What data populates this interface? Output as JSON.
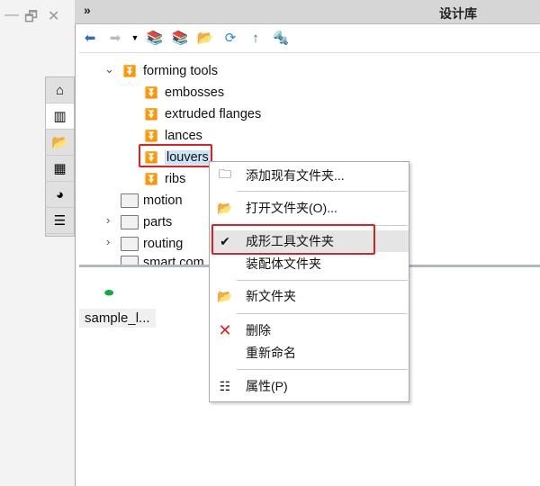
{
  "window": {
    "title": "设计库",
    "expand_icon": "double-chevron-right-icon"
  },
  "toolbar": [
    "back-icon",
    "forward-icon",
    "dropdown-icon",
    "add-library-icon",
    "new-library-icon",
    "new-folder-icon",
    "refresh-icon",
    "up-icon",
    "toolbox-icon"
  ],
  "tabs": [
    "home-icon",
    "design-library-icon",
    "file-explorer-icon",
    "view-palette-icon",
    "appearances-icon",
    "custom-properties-icon"
  ],
  "tree": {
    "root": "forming tools",
    "children": [
      "embosses",
      "extruded flanges",
      "lances",
      "louvers",
      "ribs"
    ],
    "siblings": [
      "motion",
      "parts",
      "routing",
      "smart com..."
    ],
    "selected": "louvers"
  },
  "lower": {
    "file": "sample_l..."
  },
  "menu": {
    "items": [
      {
        "label": "添加现有文件夹...",
        "icon": "add-folder-icon"
      },
      {
        "label": "打开文件夹(O)...",
        "icon": "open-folder-icon"
      },
      {
        "label": "成形工具文件夹",
        "icon": "check-icon",
        "checked": true
      },
      {
        "label": "装配体文件夹",
        "icon": ""
      },
      {
        "label": "新文件夹",
        "icon": "new-folder-icon"
      },
      {
        "label": "删除",
        "icon": "delete-icon"
      },
      {
        "label": "重新命名",
        "icon": ""
      },
      {
        "label": "属性(P)",
        "icon": "properties-icon"
      }
    ]
  },
  "colors": {
    "highlight": "#e02020",
    "selection": "#cce4f7"
  }
}
